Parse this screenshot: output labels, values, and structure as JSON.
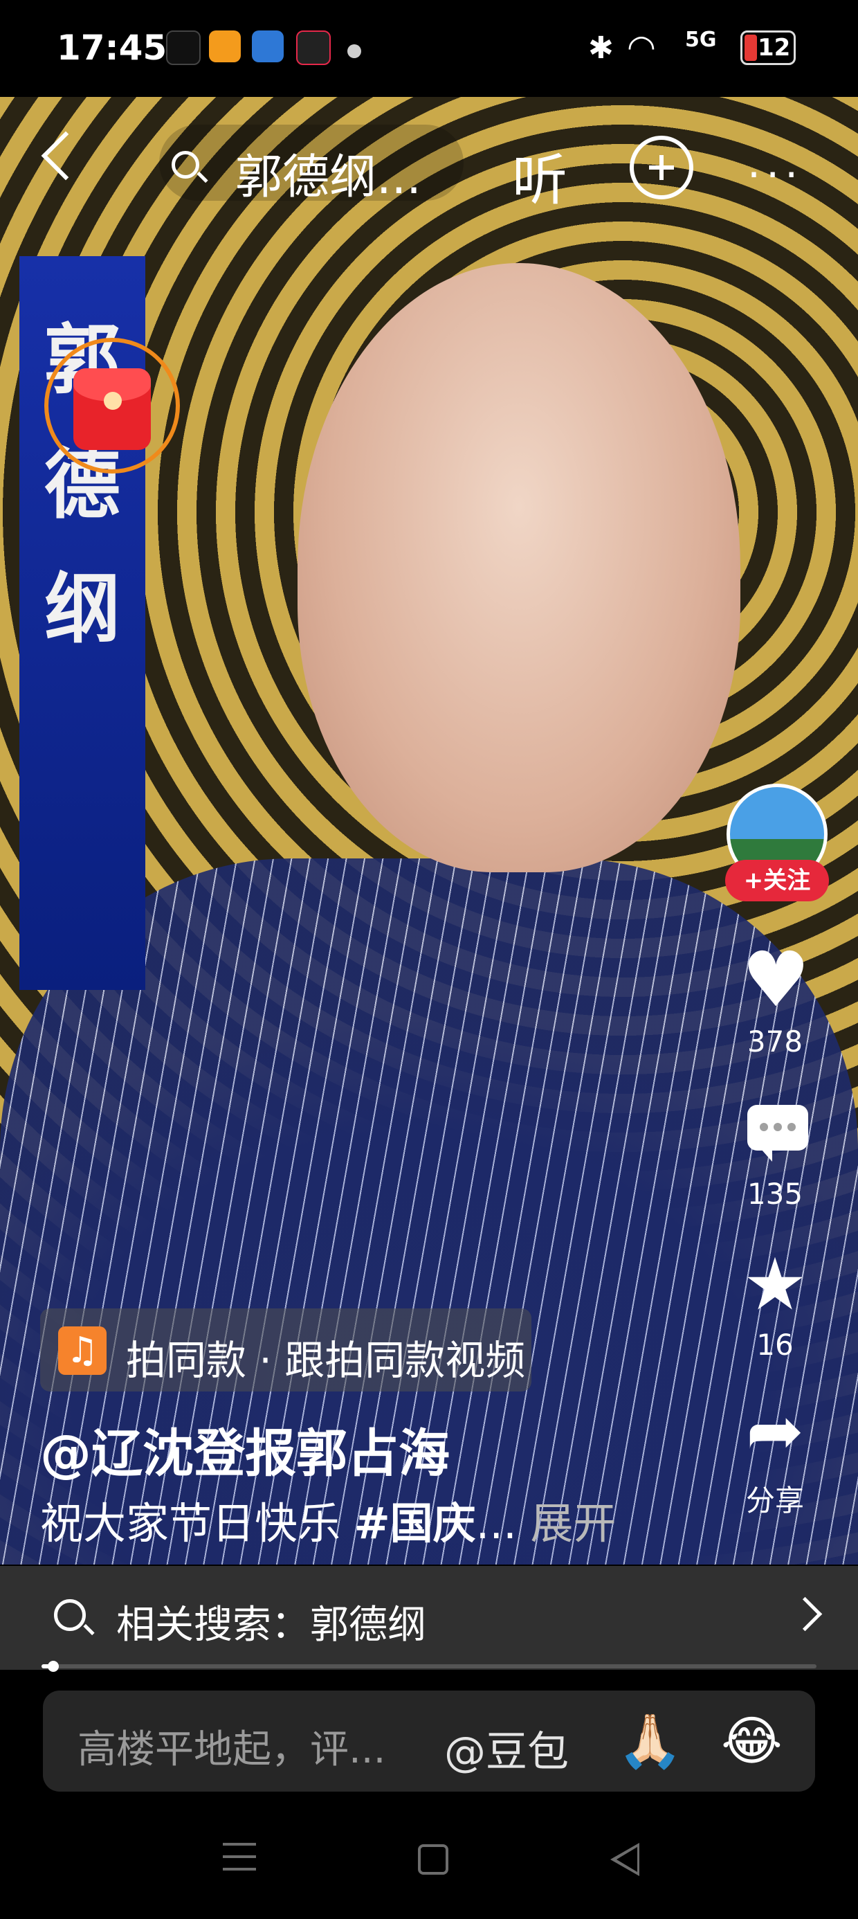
{
  "status_bar": {
    "time": "17:45",
    "network": "5G",
    "battery": "12",
    "battery_color": "#e53935"
  },
  "top_bar": {
    "search_text": "郭德纲...",
    "listen_label": "听",
    "more_label": "···"
  },
  "video": {
    "banner_text": [
      "郭",
      "德",
      "纲"
    ]
  },
  "right_rail": {
    "follow_label": "+关注",
    "likes": "378",
    "comments": "135",
    "favorites": "16",
    "share_label": "分享"
  },
  "post": {
    "tag_text": "拍同款 · 跟拍同款视频",
    "author": "@辽沈登报郭占海",
    "description": "祝大家节日快乐 ",
    "hashtag": "#国庆",
    "ellipsis": "...",
    "expand_label": " 展开"
  },
  "related_search": {
    "label": "相关搜索：郭德纲"
  },
  "progress": {
    "fraction": 0.015
  },
  "comment_bar": {
    "placeholder": "高楼平地起，评...",
    "mention": "@豆包",
    "emoji_1": "🙏🏻",
    "emoji_2": "😂"
  },
  "colors": {
    "follow_red": "#e6283b",
    "tag_orange": "#f6832c",
    "red_packet": "#e8232a"
  }
}
